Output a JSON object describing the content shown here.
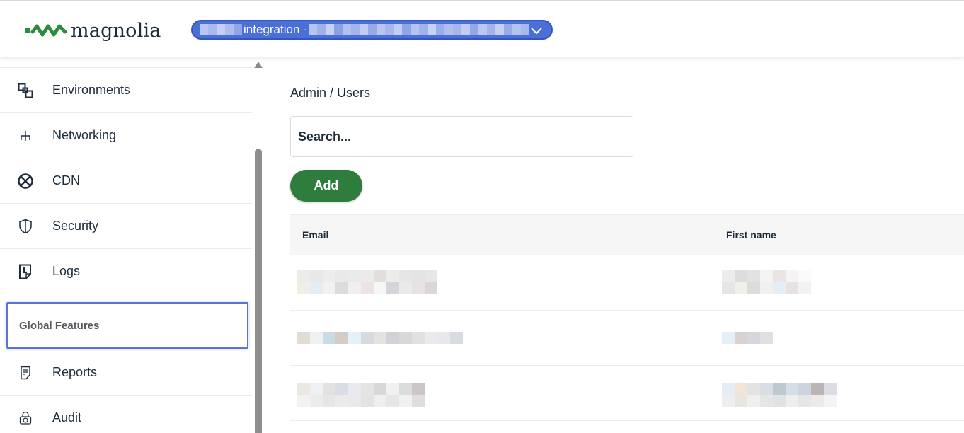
{
  "header": {
    "logo_text": "magnolia",
    "environment_select": {
      "value": "integration -",
      "icon": "chevron-down-icon"
    }
  },
  "sidebar": {
    "items": [
      {
        "label": "Environments",
        "icon": "environments-icon"
      },
      {
        "label": "Networking",
        "icon": "network-icon"
      },
      {
        "label": "CDN",
        "icon": "cdn-icon"
      },
      {
        "label": "Security",
        "icon": "shield-icon"
      },
      {
        "label": "Logs",
        "icon": "logs-icon"
      }
    ],
    "section_label": "Global Features",
    "section_items": [
      {
        "label": "Reports",
        "icon": "report-icon"
      },
      {
        "label": "Audit",
        "icon": "audit-icon"
      }
    ]
  },
  "main": {
    "breadcrumb": "Admin / Users",
    "search": {
      "placeholder": "Search..."
    },
    "add_button": "Add",
    "table": {
      "columns": [
        "Email",
        "First name"
      ]
    }
  },
  "colors": {
    "brand_green": "#2e7d3c",
    "select_blue": "#4a6fd6",
    "focus_outline": "#5b73d8"
  }
}
